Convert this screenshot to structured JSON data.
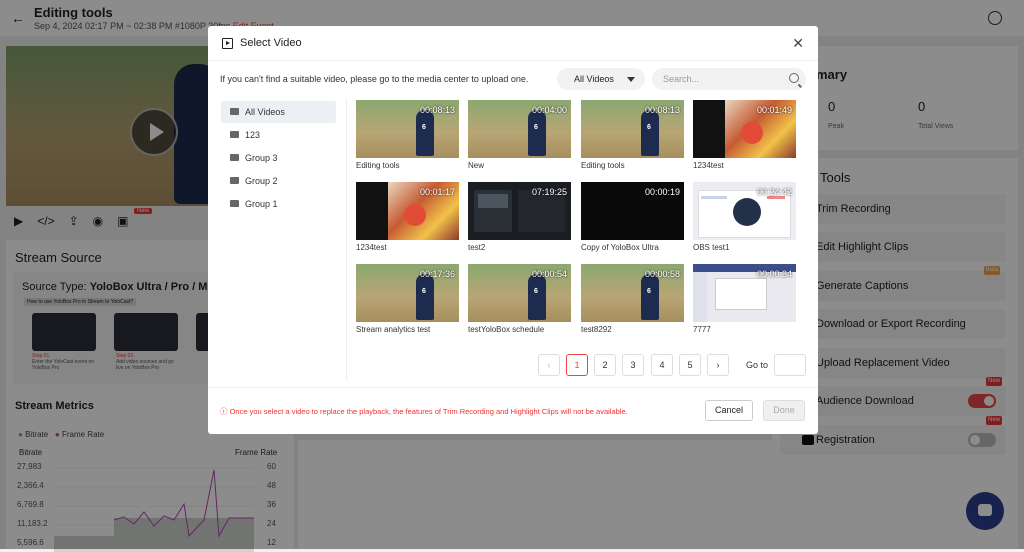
{
  "header": {
    "title": "Editing tools",
    "subtitle": "Sep 4, 2024 02:17 PM ~ 02:38 PM #1080P 30fps",
    "edit_event": "Edit Event"
  },
  "left": {
    "new_badge": "New",
    "stream_source": {
      "title": "Stream Source",
      "type_label": "Source Type:",
      "type_value": "YoloBox Ultra / Pro / Mini",
      "banner": "How to use YoloBox Pro to Stream to YoloCast?",
      "steps": [
        {
          "title": "Step 01",
          "text": "Enter the YoloCast event on YoloBox Pro"
        },
        {
          "title": "Step 02",
          "text": "Add video sources and go live on YoloBox Pro"
        },
        {
          "title": "Step 03",
          "text": ""
        }
      ]
    },
    "metrics": {
      "title": "Stream Metrics",
      "legend_bitrate": "Bitrate",
      "legend_framerate": "Frame Rate",
      "left_axis": "Bitrate",
      "right_axis": "Frame Rate",
      "left_ticks": [
        "27,983",
        "2,366.4",
        "6,769.8",
        "11,183.2",
        "5,596.6"
      ],
      "right_ticks": [
        "60",
        "48",
        "36",
        "24",
        "12"
      ]
    }
  },
  "right": {
    "summary_title": "mary",
    "peak_value": "0",
    "peak_label": "Peak",
    "views_value": "0",
    "views_label": "Total Views",
    "tools_title": "Tools",
    "tools": [
      {
        "label": "Trim Recording"
      },
      {
        "label": "Edit Highlight Clips"
      },
      {
        "label": "Generate Captions",
        "badge": "Beta"
      },
      {
        "label": "Download or Export Recording"
      },
      {
        "label": "Upload Replacement Video"
      },
      {
        "label": "Audience Download",
        "badge": "New"
      },
      {
        "label": "Registration",
        "badge": "New"
      }
    ],
    "toggles": {
      "audience_download": true,
      "registration": false
    }
  },
  "modal": {
    "title": "Select Video",
    "info": "If you can't find a suitable video, please go to the media center to upload one.",
    "filter": "All Videos",
    "search_placeholder": "Search...",
    "folders": [
      "All Videos",
      "123",
      "Group 3",
      "Group 2",
      "Group 1"
    ],
    "videos": [
      {
        "name": "Editing tools",
        "duration": "00:08:13",
        "thumb": "field"
      },
      {
        "name": "New",
        "duration": "00:04:00",
        "thumb": "field"
      },
      {
        "name": "Editing tools",
        "duration": "00:08:13",
        "thumb": "field"
      },
      {
        "name": "1234test",
        "duration": "00:01:49",
        "thumb": "food"
      },
      {
        "name": "1234test",
        "duration": "00:01:17",
        "thumb": "food"
      },
      {
        "name": "test2",
        "duration": "07:19:25",
        "thumb": "app"
      },
      {
        "name": "Copy of YoloBox Ultra",
        "duration": "00:00:19",
        "thumb": "dark"
      },
      {
        "name": "OBS test1",
        "duration": "00:24:42",
        "thumb": "web"
      },
      {
        "name": "Stream analytics test",
        "duration": "00:17:36",
        "thumb": "field"
      },
      {
        "name": "testYoloBox schedule",
        "duration": "00:00:54",
        "thumb": "field"
      },
      {
        "name": "test8292",
        "duration": "00:00:58",
        "thumb": "field"
      },
      {
        "name": "7777",
        "duration": "00:00:34",
        "thumb": "web2"
      }
    ],
    "pagination": {
      "prev": "‹",
      "next": "›",
      "pages": [
        "1",
        "2",
        "3",
        "4",
        "5"
      ],
      "current": "1",
      "goto_label": "Go to"
    },
    "warning": "ⓘ Once you select a video to replace the playback, the features of Trim Recording and Highlight Clips will not be available.",
    "cancel": "Cancel",
    "done": "Done"
  }
}
